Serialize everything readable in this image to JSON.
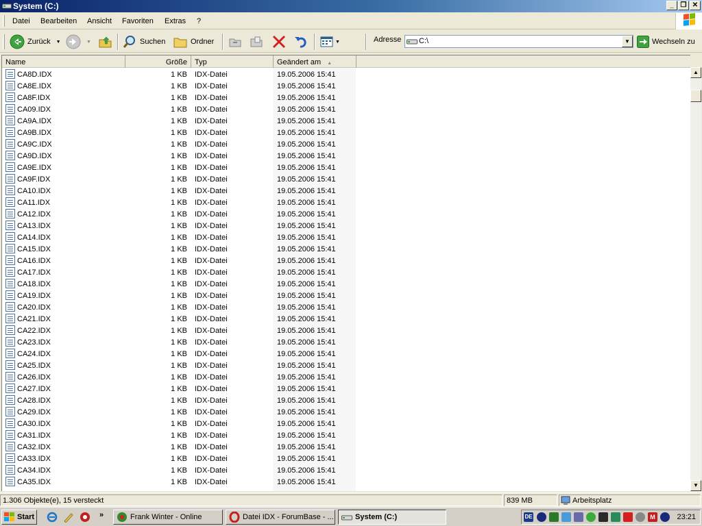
{
  "window": {
    "title": "System (C:)"
  },
  "window_controls": {
    "minimize": "_",
    "restore": "❐",
    "close": "✕"
  },
  "menu": {
    "items": [
      "Datei",
      "Bearbeiten",
      "Ansicht",
      "Favoriten",
      "Extras",
      "?"
    ]
  },
  "toolbar": {
    "back": "Zurück",
    "search": "Suchen",
    "folders": "Ordner",
    "address_label": "Adresse",
    "address_value": "C:\\",
    "go": "Wechseln zu"
  },
  "columns": {
    "name": "Name",
    "size": "Größe",
    "type": "Typ",
    "modified": "Geändert am"
  },
  "files": [
    {
      "name": "CA8D.IDX",
      "size": "1 KB",
      "type": "IDX-Datei",
      "modified": "19.05.2006 15:41"
    },
    {
      "name": "CA8E.IDX",
      "size": "1 KB",
      "type": "IDX-Datei",
      "modified": "19.05.2006 15:41"
    },
    {
      "name": "CA8F.IDX",
      "size": "1 KB",
      "type": "IDX-Datei",
      "modified": "19.05.2006 15:41"
    },
    {
      "name": "CA09.IDX",
      "size": "1 KB",
      "type": "IDX-Datei",
      "modified": "19.05.2006 15:41"
    },
    {
      "name": "CA9A.IDX",
      "size": "1 KB",
      "type": "IDX-Datei",
      "modified": "19.05.2006 15:41"
    },
    {
      "name": "CA9B.IDX",
      "size": "1 KB",
      "type": "IDX-Datei",
      "modified": "19.05.2006 15:41"
    },
    {
      "name": "CA9C.IDX",
      "size": "1 KB",
      "type": "IDX-Datei",
      "modified": "19.05.2006 15:41"
    },
    {
      "name": "CA9D.IDX",
      "size": "1 KB",
      "type": "IDX-Datei",
      "modified": "19.05.2006 15:41"
    },
    {
      "name": "CA9E.IDX",
      "size": "1 KB",
      "type": "IDX-Datei",
      "modified": "19.05.2006 15:41"
    },
    {
      "name": "CA9F.IDX",
      "size": "1 KB",
      "type": "IDX-Datei",
      "modified": "19.05.2006 15:41"
    },
    {
      "name": "CA10.IDX",
      "size": "1 KB",
      "type": "IDX-Datei",
      "modified": "19.05.2006 15:41"
    },
    {
      "name": "CA11.IDX",
      "size": "1 KB",
      "type": "IDX-Datei",
      "modified": "19.05.2006 15:41"
    },
    {
      "name": "CA12.IDX",
      "size": "1 KB",
      "type": "IDX-Datei",
      "modified": "19.05.2006 15:41"
    },
    {
      "name": "CA13.IDX",
      "size": "1 KB",
      "type": "IDX-Datei",
      "modified": "19.05.2006 15:41"
    },
    {
      "name": "CA14.IDX",
      "size": "1 KB",
      "type": "IDX-Datei",
      "modified": "19.05.2006 15:41"
    },
    {
      "name": "CA15.IDX",
      "size": "1 KB",
      "type": "IDX-Datei",
      "modified": "19.05.2006 15:41"
    },
    {
      "name": "CA16.IDX",
      "size": "1 KB",
      "type": "IDX-Datei",
      "modified": "19.05.2006 15:41"
    },
    {
      "name": "CA17.IDX",
      "size": "1 KB",
      "type": "IDX-Datei",
      "modified": "19.05.2006 15:41"
    },
    {
      "name": "CA18.IDX",
      "size": "1 KB",
      "type": "IDX-Datei",
      "modified": "19.05.2006 15:41"
    },
    {
      "name": "CA19.IDX",
      "size": "1 KB",
      "type": "IDX-Datei",
      "modified": "19.05.2006 15:41"
    },
    {
      "name": "CA20.IDX",
      "size": "1 KB",
      "type": "IDX-Datei",
      "modified": "19.05.2006 15:41"
    },
    {
      "name": "CA21.IDX",
      "size": "1 KB",
      "type": "IDX-Datei",
      "modified": "19.05.2006 15:41"
    },
    {
      "name": "CA22.IDX",
      "size": "1 KB",
      "type": "IDX-Datei",
      "modified": "19.05.2006 15:41"
    },
    {
      "name": "CA23.IDX",
      "size": "1 KB",
      "type": "IDX-Datei",
      "modified": "19.05.2006 15:41"
    },
    {
      "name": "CA24.IDX",
      "size": "1 KB",
      "type": "IDX-Datei",
      "modified": "19.05.2006 15:41"
    },
    {
      "name": "CA25.IDX",
      "size": "1 KB",
      "type": "IDX-Datei",
      "modified": "19.05.2006 15:41"
    },
    {
      "name": "CA26.IDX",
      "size": "1 KB",
      "type": "IDX-Datei",
      "modified": "19.05.2006 15:41"
    },
    {
      "name": "CA27.IDX",
      "size": "1 KB",
      "type": "IDX-Datei",
      "modified": "19.05.2006 15:41"
    },
    {
      "name": "CA28.IDX",
      "size": "1 KB",
      "type": "IDX-Datei",
      "modified": "19.05.2006 15:41"
    },
    {
      "name": "CA29.IDX",
      "size": "1 KB",
      "type": "IDX-Datei",
      "modified": "19.05.2006 15:41"
    },
    {
      "name": "CA30.IDX",
      "size": "1 KB",
      "type": "IDX-Datei",
      "modified": "19.05.2006 15:41"
    },
    {
      "name": "CA31.IDX",
      "size": "1 KB",
      "type": "IDX-Datei",
      "modified": "19.05.2006 15:41"
    },
    {
      "name": "CA32.IDX",
      "size": "1 KB",
      "type": "IDX-Datei",
      "modified": "19.05.2006 15:41"
    },
    {
      "name": "CA33.IDX",
      "size": "1 KB",
      "type": "IDX-Datei",
      "modified": "19.05.2006 15:41"
    },
    {
      "name": "CA34.IDX",
      "size": "1 KB",
      "type": "IDX-Datei",
      "modified": "19.05.2006 15:41"
    },
    {
      "name": "CA35.IDX",
      "size": "1 KB",
      "type": "IDX-Datei",
      "modified": "19.05.2006 15:41"
    }
  ],
  "status": {
    "objects": "1.306 Objekte(e), 15 versteckt",
    "size": "839 MB",
    "location": "Arbeitsplatz"
  },
  "taskbar": {
    "start": "Start",
    "tasks": [
      "Frank Winter - Online",
      "Datei IDX - ForumBase - ...",
      "System (C:)"
    ],
    "tray_lang": "DE",
    "clock": "23:21"
  }
}
